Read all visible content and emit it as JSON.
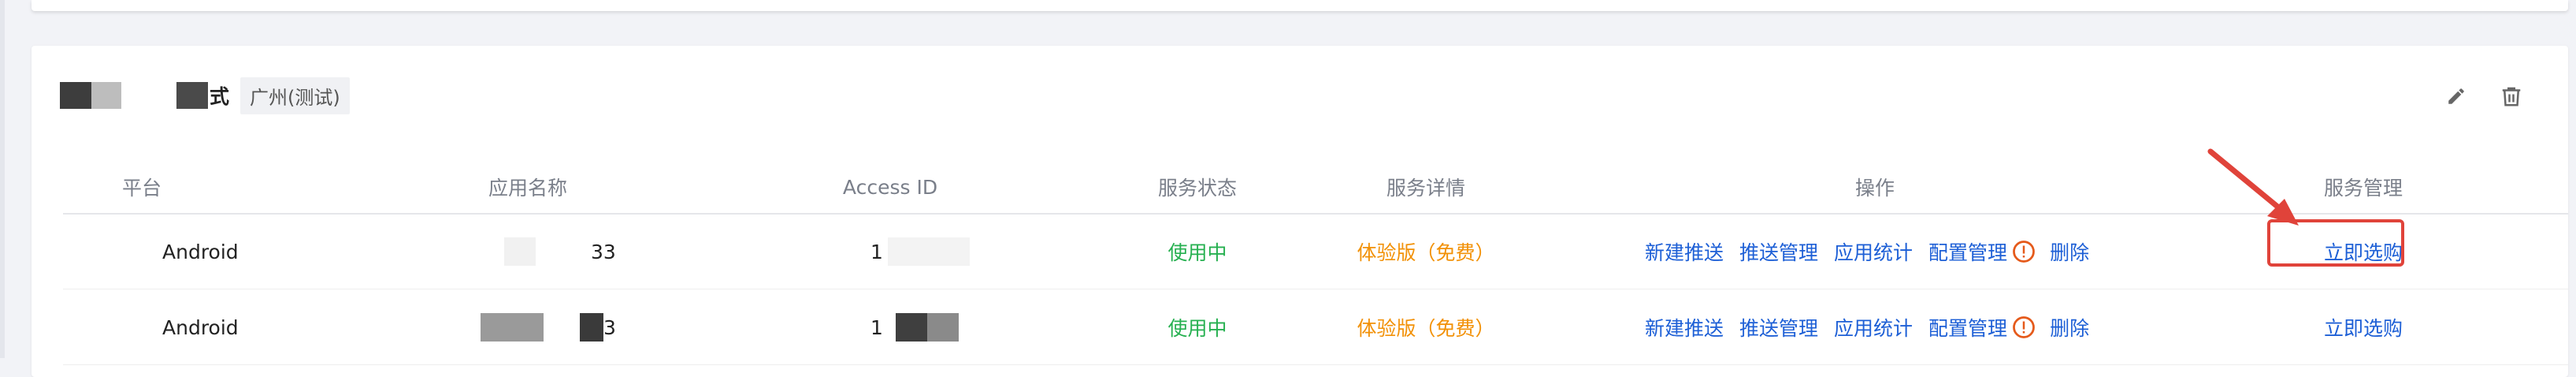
{
  "card": {
    "title_tail": "式",
    "region_tag": "广州(测试)"
  },
  "table": {
    "columns": [
      "平台",
      "应用名称",
      "Access ID",
      "服务状态",
      "服务详情",
      "操作",
      "服务管理"
    ],
    "rows": [
      {
        "platform": "Android",
        "app_name_suffix": "33",
        "access_id_prefix": "1",
        "status": "使用中",
        "plan": "体验版（免费）",
        "manage": "立即选购"
      },
      {
        "platform": "Android",
        "app_name_suffix": "3",
        "access_id_prefix": "1",
        "status": "使用中",
        "plan": "体验版（免费）",
        "manage": "立即选购"
      }
    ],
    "operations": [
      "新建推送",
      "推送管理",
      "应用统计",
      "配置管理",
      "删除"
    ]
  },
  "colors": {
    "status": "#26b050",
    "plan": "#f29107",
    "link": "#1d5fd6",
    "highlight": "#e0433a"
  },
  "icons": [
    "edit-icon",
    "trash-icon",
    "warning-icon",
    "arrow-annotation"
  ]
}
